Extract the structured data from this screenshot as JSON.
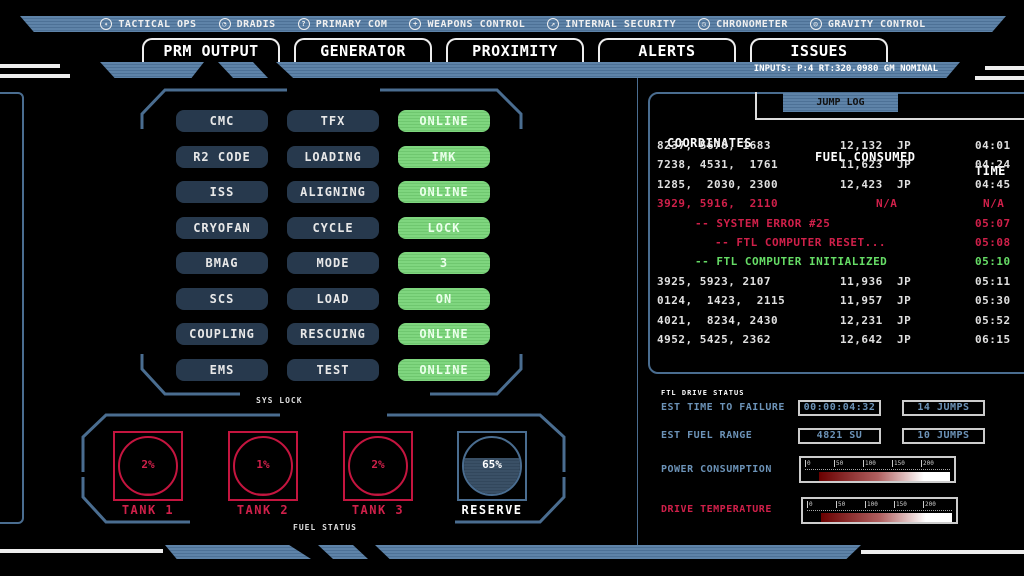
{
  "nav": [
    {
      "label": "TACTICAL OPS",
      "icon": "tactical-icon"
    },
    {
      "label": "DRADIS",
      "icon": "radar-icon"
    },
    {
      "label": "PRIMARY COM",
      "icon": "com-icon"
    },
    {
      "label": "WEAPONS CONTROL",
      "icon": "crosshair-icon"
    },
    {
      "label": "INTERNAL SECURITY",
      "icon": "gauge-icon"
    },
    {
      "label": "CHRONOMETER",
      "icon": "clock-icon"
    },
    {
      "label": "GRAVITY CONTROL",
      "icon": "gravity-icon"
    }
  ],
  "tabs": [
    "PRM OUTPUT",
    "GENERATOR",
    "PROXIMITY",
    "ALERTS",
    "ISSUES"
  ],
  "status_line": "INPUTS:  P:4 RT:320.0980 GM NOMINAL",
  "systems": [
    [
      "CMC",
      "TFX",
      "ONLINE"
    ],
    [
      "R2 CODE",
      "LOADING",
      "IMK"
    ],
    [
      "ISS",
      "ALIGNING",
      "ONLINE"
    ],
    [
      "CRYOFAN",
      "CYCLE",
      "LOCK"
    ],
    [
      "BMAG",
      "MODE",
      "3"
    ],
    [
      "SCS",
      "LOAD",
      "ON"
    ],
    [
      "COUPLING",
      "RESCUING",
      "ONLINE"
    ],
    [
      "EMS",
      "TEST",
      "ONLINE"
    ]
  ],
  "sys_lock_label": "SYS LOCK",
  "fuel": {
    "title": "FUEL STATUS",
    "tanks": [
      {
        "label": "TANK 1",
        "pct": "2%",
        "level": 2
      },
      {
        "label": "TANK 2",
        "pct": "1%",
        "level": 1
      },
      {
        "label": "TANK 3",
        "pct": "2%",
        "level": 2
      },
      {
        "label": "RESERVE",
        "pct": "65%",
        "level": 65
      }
    ]
  },
  "jump_log": {
    "title": "JUMP LOG",
    "headers": [
      "COORDINATES",
      "FUEL CONSUMED",
      "TIME"
    ],
    "rows": [
      {
        "type": "normal",
        "coords": "8237, 5678, 1683",
        "fuel": "12,132",
        "unit": "JP",
        "time": "04:01"
      },
      {
        "type": "normal",
        "coords": "7238, 4531,  1761",
        "fuel": "11,623",
        "unit": "JP",
        "time": "04:24"
      },
      {
        "type": "normal",
        "coords": "1285,  2030, 2300",
        "fuel": "12,423",
        "unit": "JP",
        "time": "04:45"
      },
      {
        "type": "error",
        "coords": "3929, 5916,  2110",
        "fuel": "N/A",
        "unit": "",
        "time": "N/A"
      },
      {
        "type": "error-msg",
        "msg": "-- SYSTEM ERROR #25",
        "time": "05:07"
      },
      {
        "type": "error-msg2",
        "msg": "-- FTL COMPUTER RESET...",
        "time": "05:08"
      },
      {
        "type": "ok-msg",
        "msg": "-- FTL COMPUTER INITIALIZED",
        "time": "05:10"
      },
      {
        "type": "normal",
        "coords": "3925, 5923, 2107",
        "fuel": "11,936",
        "unit": "JP",
        "time": "05:11"
      },
      {
        "type": "normal",
        "coords": "0124,  1423,  2115",
        "fuel": "11,957",
        "unit": "JP",
        "time": "05:30"
      },
      {
        "type": "normal",
        "coords": "4021,  8234, 2430",
        "fuel": "12,231",
        "unit": "JP",
        "time": "05:52"
      },
      {
        "type": "normal",
        "coords": "4952, 5425, 2362",
        "fuel": "12,642",
        "unit": "JP",
        "time": "06:15"
      }
    ]
  },
  "ftl": {
    "title": "FTL DRIVE STATUS",
    "time_label": "EST TIME TO FAILURE",
    "time_value": "00:00:04:32",
    "time_jumps": "14 JUMPS",
    "range_label": "EST FUEL RANGE",
    "range_value": "4821 SU",
    "range_jumps": "10 JUMPS",
    "power_label": "POWER CONSUMPTION",
    "temp_label": "DRIVE TEMPERATURE",
    "scale": [
      "0",
      "50",
      "100",
      "150",
      "200"
    ]
  },
  "colors": {
    "accent": "#5e83a8",
    "online": "#7fd67f",
    "error": "#c4153f",
    "ok": "#66dd66",
    "cell": "#27394d"
  }
}
